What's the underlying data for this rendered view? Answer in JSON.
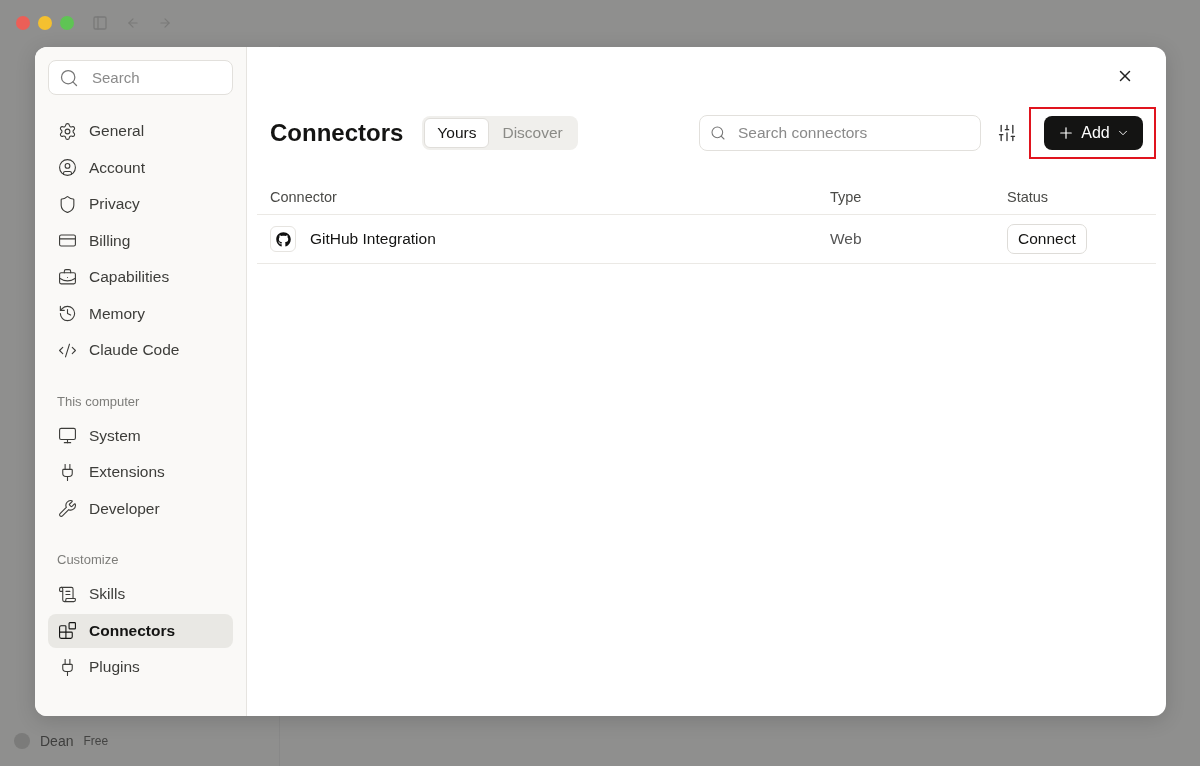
{
  "background_app": {
    "user": {
      "name": "Dean",
      "plan": "Free"
    }
  },
  "settings_dialog": {
    "sidebar": {
      "search": {
        "placeholder": "Search"
      },
      "sections": [
        {
          "items": [
            {
              "label": "General",
              "selected": false
            },
            {
              "label": "Account",
              "selected": false
            },
            {
              "label": "Privacy",
              "selected": false
            },
            {
              "label": "Billing",
              "selected": false
            },
            {
              "label": "Capabilities",
              "selected": false
            },
            {
              "label": "Memory",
              "selected": false
            },
            {
              "label": "Claude Code",
              "selected": false
            }
          ]
        },
        {
          "heading": "This computer",
          "items": [
            {
              "label": "System",
              "selected": false
            },
            {
              "label": "Extensions",
              "selected": false
            },
            {
              "label": "Developer",
              "selected": false
            }
          ]
        },
        {
          "heading": "Customize",
          "items": [
            {
              "label": "Skills",
              "selected": false
            },
            {
              "label": "Connectors",
              "selected": true
            },
            {
              "label": "Plugins",
              "selected": false
            }
          ]
        }
      ]
    },
    "main": {
      "title": "Connectors",
      "tabs": [
        {
          "label": "Yours",
          "selected": true
        },
        {
          "label": "Discover",
          "selected": false
        }
      ],
      "search": {
        "placeholder": "Search connectors"
      },
      "add_button": {
        "label": "Add",
        "highlighted": true
      },
      "table": {
        "columns": [
          "Connector",
          "Type",
          "Status"
        ],
        "rows": [
          {
            "connector": "GitHub Integration",
            "type": "Web",
            "action": "Connect"
          }
        ]
      }
    }
  }
}
